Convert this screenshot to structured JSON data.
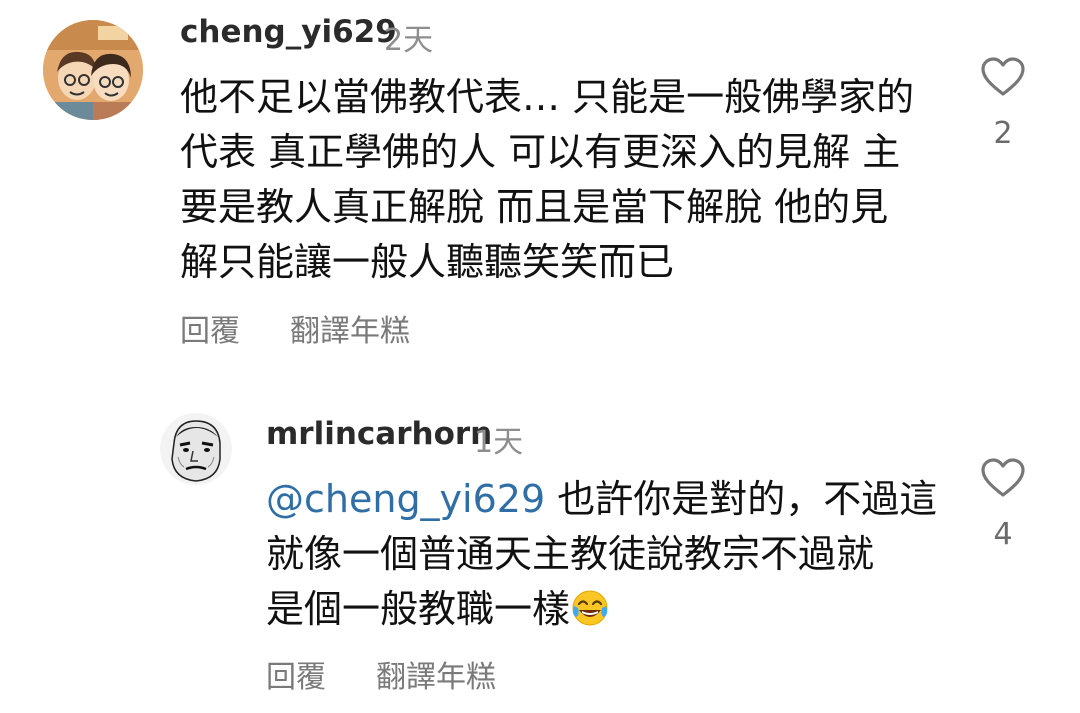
{
  "comments": [
    {
      "username": "cheng_yi629",
      "time": "2天",
      "lines": [
        "他不足以當佛教代表… 只能是一般佛學家的",
        "代表 真正學佛的人 可以有更深入的見解 主",
        "要是教人真正解脫 而且是當下解脫 他的見",
        "解只能讓一般人聽聽笑笑而已"
      ],
      "reply_label": "回覆",
      "translate_label": "翻譯年糕",
      "like_count": "2",
      "avatar_icon": "couple-cartoon-avatar"
    },
    {
      "username": "mrlincarhorn",
      "time": "1天",
      "mention": "@cheng_yi629",
      "line1_rest": " 也許你是對的，不過這",
      "line2": "就像一個普通天主教徒說教宗不過就",
      "line3": "是個一般教職一樣",
      "emoji_icon": "face-with-tears-of-joy-icon",
      "reply_label": "回覆",
      "translate_label": "翻譯年糕",
      "like_count": "4",
      "avatar_icon": "meme-face-avatar"
    }
  ],
  "colors": {
    "mention": "#2f6fa6",
    "secondary_text": "#8e8e8e",
    "username": "#2b2b2b"
  }
}
